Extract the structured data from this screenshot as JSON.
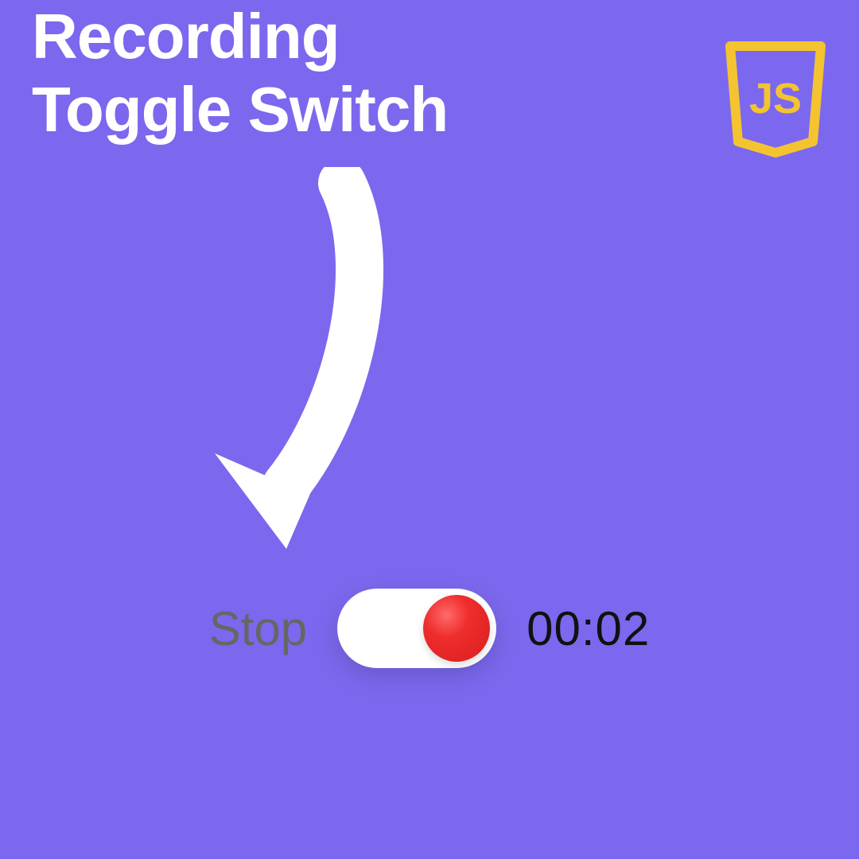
{
  "header": {
    "title_line1": "Recording",
    "title_line2": "Toggle Switch",
    "badge_text": "JS"
  },
  "toggle": {
    "label": "Stop",
    "state": "on",
    "timer": "00:02"
  },
  "colors": {
    "background": "#7B68EE",
    "badge": "#F4C430",
    "knob": "#E53935"
  }
}
